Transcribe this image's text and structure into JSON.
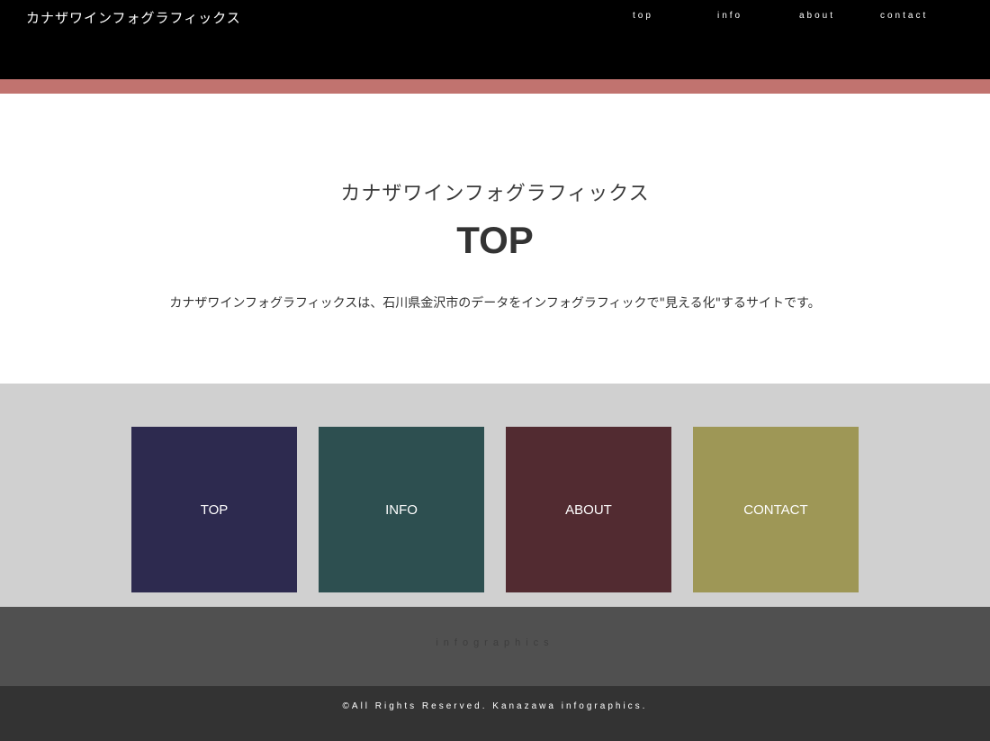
{
  "header": {
    "brand": "カナザワインフォグラフィックス",
    "nav": [
      {
        "label": "top"
      },
      {
        "label": "info"
      },
      {
        "label": "about"
      },
      {
        "label": "contact"
      }
    ]
  },
  "hero": {
    "site_name": "カナザワインフォグラフィックス",
    "page_title": "TOP",
    "description": "カナザワインフォグラフィックスは、石川県金沢市のデータをインフォグラフィックで\"見える化\"するサイトです。"
  },
  "tiles": [
    {
      "label": "TOP",
      "color": "#2d2a4f"
    },
    {
      "label": "INFO",
      "color": "#2d4f50"
    },
    {
      "label": "ABOUT",
      "color": "#522b31"
    },
    {
      "label": "CONTACT",
      "color": "#9e9756"
    }
  ],
  "footer": {
    "label": "infographics",
    "copyright": "©All Rights Reserved. Kanazawa infographics."
  },
  "colors": {
    "header_bg": "#000000",
    "accent": "#c1736f",
    "tiles_bg": "#d0d0d0",
    "footer_top_bg": "#505050",
    "footer_bottom_bg": "#333333"
  }
}
